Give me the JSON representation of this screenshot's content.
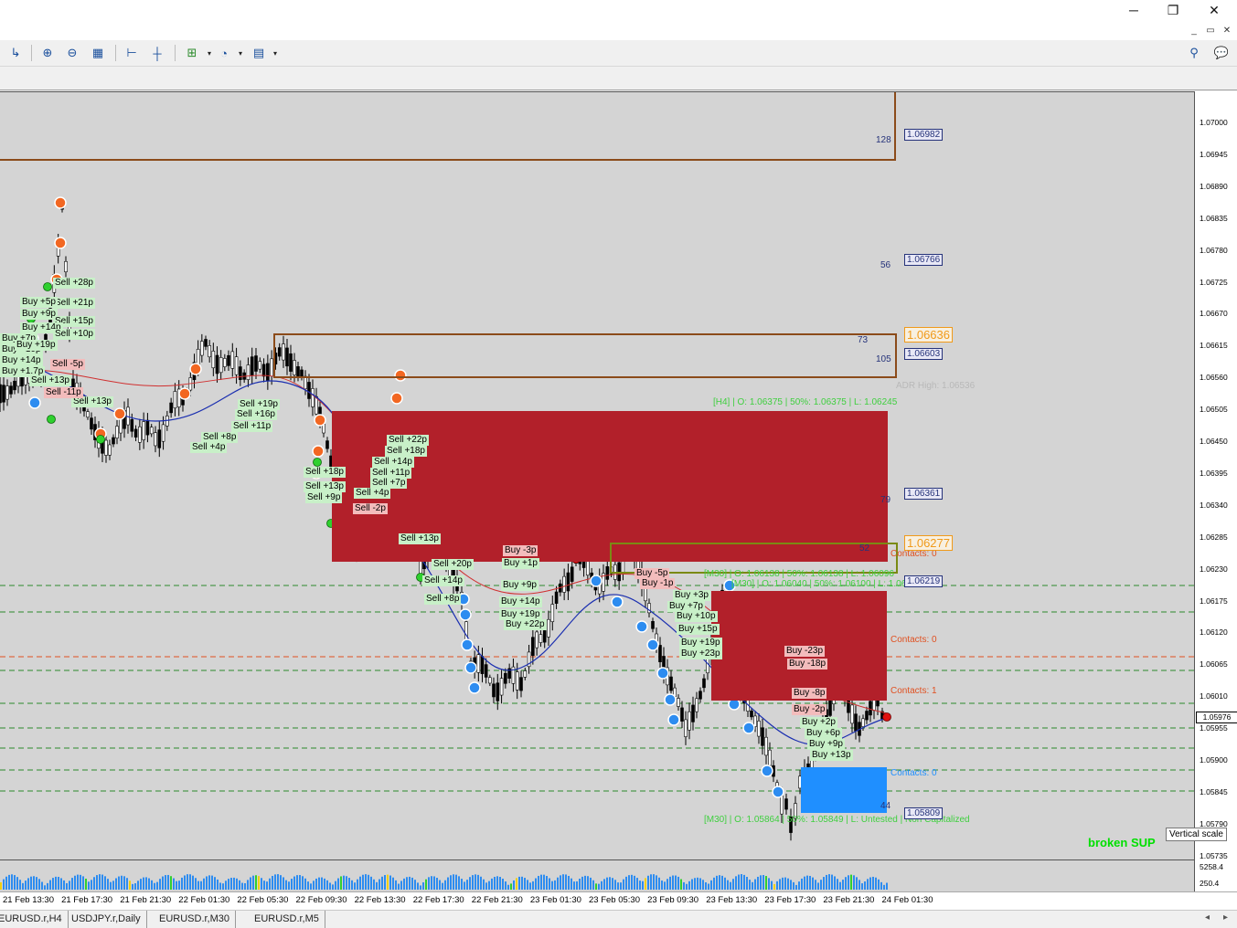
{
  "window": {
    "minimize": "─",
    "maximize": "❐",
    "close": "✕"
  },
  "price_axis": {
    "ticks": [
      "1.07000",
      "1.06945",
      "1.06890",
      "1.06835",
      "1.06780",
      "1.06725",
      "1.06670",
      "1.06615",
      "1.06560",
      "1.06505",
      "1.06450",
      "1.06395",
      "1.06340",
      "1.06285",
      "1.06230",
      "1.06175",
      "1.06120",
      "1.06065",
      "1.06010",
      "1.05955",
      "1.05900",
      "1.05845",
      "1.05790",
      "1.05735"
    ],
    "current_price": "1.05976",
    "volume_ticks": [
      "5258.4",
      "250.4"
    ]
  },
  "time_axis": [
    "21 Feb 13:30",
    "21 Feb 17:30",
    "21 Feb 21:30",
    "22 Feb 01:30",
    "22 Feb 05:30",
    "22 Feb 09:30",
    "22 Feb 13:30",
    "22 Feb 17:30",
    "22 Feb 21:30",
    "23 Feb 01:30",
    "23 Feb 05:30",
    "23 Feb 09:30",
    "23 Feb 13:30",
    "23 Feb 17:30",
    "23 Feb 21:30",
    "24 Feb 01:30"
  ],
  "tabs": [
    "EURUSD.r,H4",
    "USDJPY.r,Daily",
    "EURUSD.r,M30",
    "EURUSD.r,M5"
  ],
  "levels": {
    "tags": [
      "1.06982",
      "1.06766",
      "1.06603",
      "1.06361",
      "1.06219",
      "1.05809"
    ],
    "tags_orange": [
      "1.06636",
      "1.06277"
    ],
    "numbers": [
      "128",
      "56",
      "73",
      "105",
      "79",
      "52",
      "44"
    ],
    "adr_high": "ADR High: 1.06536",
    "h4_info": "[H4] | O: 1.06375 | 50%: 1.06375 | L: 1.06245",
    "m30_info_1": "[M30] | O: 1.06040 | 50%: 1.06100 | L: 1.06135",
    "m30_info_2": "[M30] | O: 1.06138 | 50%: 1.06138 | L: 1.06096",
    "m30_info_3": "[M30] | O: 1.05864 | 50%: 1.05849 | L: Untested | Non Capitalized",
    "contacts": [
      "Contacts: 0",
      "Contacts: 0",
      "Contacts: 1",
      "Contacts: 0"
    ],
    "broken": "broken SUP",
    "tooltip": "Vertical scale"
  },
  "trade_labels_green": [
    "Sell +28p",
    "Sell +21p",
    "Buy +5p",
    "Buy +9p",
    "Sell +15p",
    "Buy +14p",
    "Sell +10p",
    "Buy +7p",
    "Buy +10p",
    "Buy +19p",
    "Buy +14p",
    "Buy +1.7p",
    "Sell +13p",
    "Sell +13p",
    "Sell +19p",
    "Sell +16p",
    "Sell +11p",
    "Sell +8p",
    "Sell +4p",
    "Sell +18p",
    "Sell +13p",
    "Sell +9p",
    "Sell +22p",
    "Sell +18p",
    "Sell +14p",
    "Sell +11p",
    "Sell +7p",
    "Sell +4p",
    "Sell +13p",
    "Sell +20p",
    "Sell +14p",
    "Sell +8p",
    "Buy +1p",
    "Buy +9p",
    "Buy +14p",
    "Buy +19p",
    "Buy +22p",
    "Buy +3p",
    "Buy +7p",
    "Buy +10p",
    "Buy +15p",
    "Buy +19p",
    "Buy +23p",
    "Buy +2p",
    "Buy +6p",
    "Buy +9p",
    "Buy +13p"
  ],
  "trade_labels_red": [
    "Sell -5p",
    "Sell -11p",
    "Sell -2p",
    "Buy -3p",
    "Buy -5p",
    "Buy -1p",
    "Buy -23p",
    "Buy -18p",
    "Buy -8p",
    "Buy -2p"
  ]
}
